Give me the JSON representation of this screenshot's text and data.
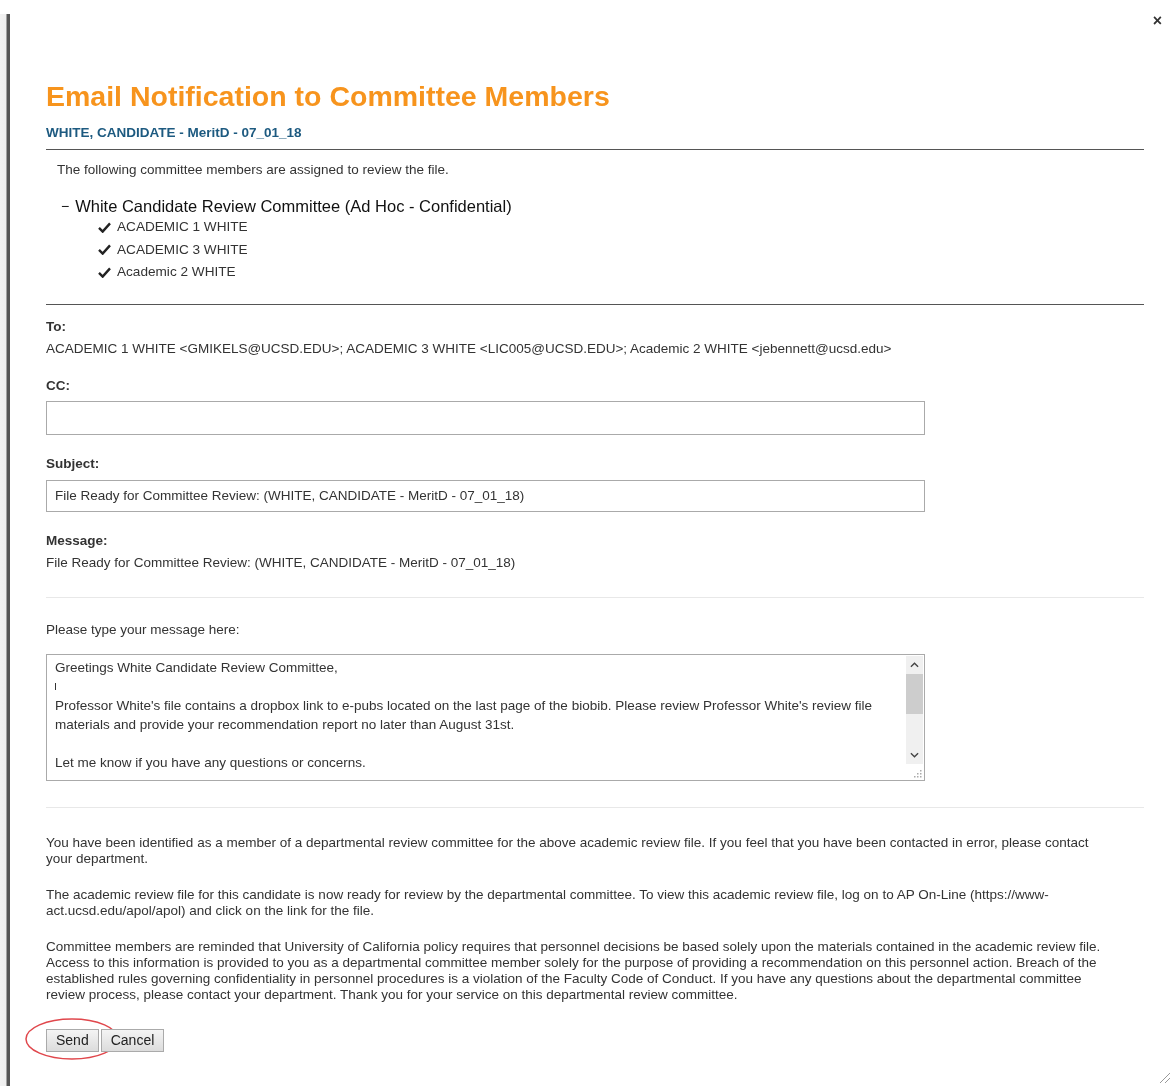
{
  "close_button": "×",
  "title": "Email Notification to Committee Members",
  "subtitle": "WHITE, CANDIDATE - MeritD - 07_01_18",
  "intro": "The following committee members are assigned to review the file.",
  "committee": {
    "toggle": "−",
    "name": "White Candidate Review Committee (Ad Hoc - Confidential)",
    "expanded": true,
    "members": [
      {
        "name": "ACADEMIC 1 WHITE",
        "checked": true
      },
      {
        "name": "ACADEMIC 3 WHITE",
        "checked": true
      },
      {
        "name": "Academic 2 WHITE",
        "checked": true
      }
    ]
  },
  "to": {
    "label": "To:",
    "value": "ACADEMIC 1 WHITE <GMIKELS@UCSD.EDU>; ACADEMIC 3 WHITE <LIC005@UCSD.EDU>; Academic 2 WHITE <jebennett@ucsd.edu>"
  },
  "cc": {
    "label": "CC:"
  },
  "subject": {
    "label": "Subject:",
    "value": "File Ready for Committee Review: (WHITE, CANDIDATE - MeritD - 07_01_18)"
  },
  "message": {
    "label": "Message:",
    "value": "File Ready for Committee Review: (WHITE, CANDIDATE - MeritD - 07_01_18)"
  },
  "custom_message": {
    "label": "Please type your message here:",
    "paragraphs": [
      "Greetings White Candidate Review Committee,",
      "Professor White's file contains a dropbox link to e-pubs located on the last page of the biobib. Please review Professor White's review file materials and provide your recommendation report no later than August 31st.",
      "Let me know if you have any questions or concerns."
    ]
  },
  "notices": [
    "You have been identified as a member of a departmental review committee for the above academic review file. If you feel that you have been contacted in error, please contact your department.",
    "The academic review file for this candidate is now ready for review by the departmental committee. To view this academic review file, log on to AP On-Line (https://www-act.ucsd.edu/apol/apol) and click on the link for the file.",
    "Committee members are reminded that University of California policy requires that personnel decisions be based solely upon the materials contained in the academic review file. Access to this information is provided to you as a departmental committee member solely for the purpose of providing a recommendation on this personnel action. Breach of the established rules governing confidentiality in personnel procedures is a violation of the Faculty Code of Conduct. If you have any questions about the departmental committee review process, please contact your department. Thank you for your service on this departmental review committee."
  ],
  "buttons": [
    {
      "label": "Send",
      "circled": true
    },
    {
      "label": "Cancel",
      "circled": false
    }
  ]
}
